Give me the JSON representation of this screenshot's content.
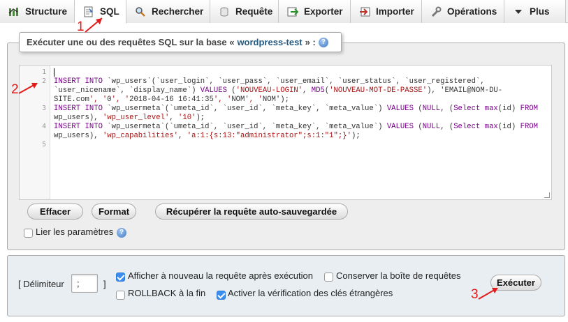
{
  "tabs": [
    {
      "label": "Structure",
      "icon": "structure-icon"
    },
    {
      "label": "SQL",
      "icon": "sql-icon",
      "active": true
    },
    {
      "label": "Rechercher",
      "icon": "search-icon"
    },
    {
      "label": "Requête",
      "icon": "query-icon"
    },
    {
      "label": "Exporter",
      "icon": "export-icon"
    },
    {
      "label": "Importer",
      "icon": "import-icon"
    },
    {
      "label": "Opérations",
      "icon": "wrench-icon"
    },
    {
      "label": "Plus",
      "icon": "chevron-down-icon"
    }
  ],
  "legend": {
    "prefix": "Exécuter une ou des requêtes SQL sur la base «",
    "database": "wordpress-test",
    "suffix": "» :"
  },
  "editor": {
    "line_numbers": [
      "1",
      "2",
      "",
      "",
      "3",
      "",
      "4",
      "",
      "5"
    ],
    "lines": [
      "",
      "INSERT INTO `wp_users`(`user_login`, `user_pass`, `user_email`, `user_status`, `user_registered`,",
      "`user_nicename`, `display_name`) VALUES ('NOUVEAU-LOGIN', MD5('NOUVEAU-MOT-DE-PASSE'), 'EMAIL@NOM-DU-",
      "SITE.com', '0', '2018-04-16 16:41:35', 'NOM', 'NOM');",
      "INSERT INTO `wp_usermeta`(`umeta_id`, `user_id`, `meta_key`, `meta_value`) VALUES (NULL, (Select max(id) FROM",
      "wp_users), 'wp_user_level', '10');",
      "INSERT INTO `wp_usermeta`(`umeta_id`, `user_id`, `meta_key`, `meta_value`) VALUES (NULL, (Select max(id) FROM",
      "wp_users), 'wp_capabilities', 'a:1:{s:13:\"administrator\";s:1:\"1\";}');",
      ""
    ]
  },
  "buttons": {
    "clear": "Effacer",
    "format": "Format",
    "autosaved": "Récupérer la requête auto-sauvegardée",
    "execute": "Exécuter"
  },
  "bind_params": {
    "label": "Lier les paramètres",
    "checked": false
  },
  "options": {
    "delimiter_label": "[ Délimiteur",
    "delimiter_close": "]",
    "delimiter_value": ";",
    "show_query": {
      "label": "Afficher à nouveau la requête après exécution",
      "checked": true
    },
    "keep_box": {
      "label": "Conserver la boîte de requêtes",
      "checked": false
    },
    "rollback": {
      "label": "ROLLBACK à la fin",
      "checked": false
    },
    "foreign_keys": {
      "label": "Activer la vérification des clés étrangères",
      "checked": true
    }
  },
  "annotations": [
    "1",
    "2",
    "3"
  ],
  "colors": {
    "annotation": "#e21b1b",
    "link": "#235a81",
    "checkbox": "#3b8ef0"
  }
}
